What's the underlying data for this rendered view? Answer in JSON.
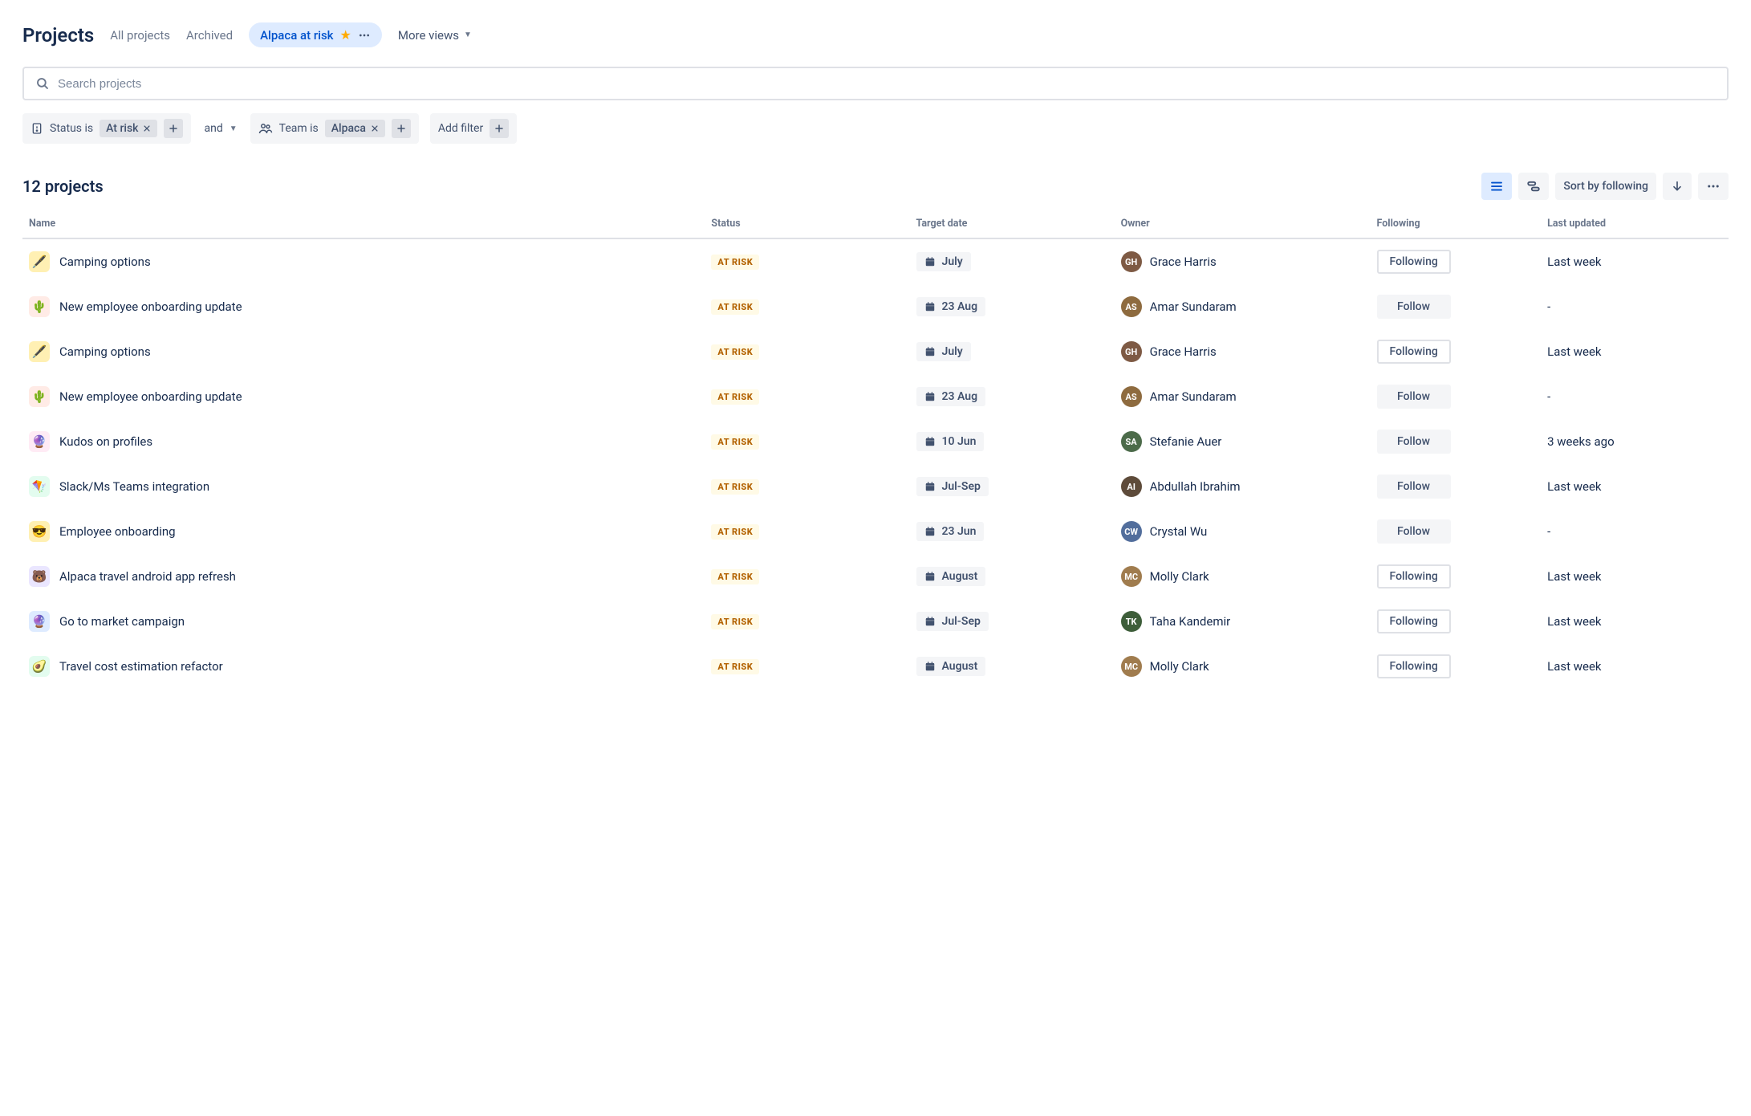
{
  "header": {
    "title": "Projects",
    "nav": {
      "all": "All projects",
      "archived": "Archived",
      "more_views": "More views"
    },
    "active_view": "Alpaca at risk"
  },
  "search": {
    "placeholder": "Search projects"
  },
  "filters": {
    "status_label": "Status is",
    "status_value": "At risk",
    "combiner": "and",
    "team_label": "Team is",
    "team_value": "Alpaca",
    "add_filter": "Add filter"
  },
  "toolbar": {
    "count": "12 projects",
    "sort_label": "Sort by following"
  },
  "columns": {
    "name": "Name",
    "status": "Status",
    "target_date": "Target date",
    "owner": "Owner",
    "following": "Following",
    "last_updated": "Last updated"
  },
  "status_badge": "AT RISK",
  "follow_labels": {
    "following": "Following",
    "follow": "Follow"
  },
  "rows": [
    {
      "icon": "🖋️",
      "icon_bg": "#FFF0B3",
      "name": "Camping options",
      "date": "July",
      "owner": "Grace Harris",
      "avatar_bg": "#7E5A44",
      "avatar_txt": "GH",
      "following": true,
      "updated": "Last week"
    },
    {
      "icon": "🌵",
      "icon_bg": "#FFEBE6",
      "name": "New employee onboarding update",
      "date": "23 Aug",
      "owner": "Amar Sundaram",
      "avatar_bg": "#8E6B3F",
      "avatar_txt": "AS",
      "following": false,
      "updated": "-"
    },
    {
      "icon": "🖋️",
      "icon_bg": "#FFF0B3",
      "name": "Camping options",
      "date": "July",
      "owner": "Grace Harris",
      "avatar_bg": "#7E5A44",
      "avatar_txt": "GH",
      "following": true,
      "updated": "Last week"
    },
    {
      "icon": "🌵",
      "icon_bg": "#FFEBE6",
      "name": "New employee onboarding update",
      "date": "23 Aug",
      "owner": "Amar Sundaram",
      "avatar_bg": "#8E6B3F",
      "avatar_txt": "AS",
      "following": false,
      "updated": "-"
    },
    {
      "icon": "🔮",
      "icon_bg": "#FFEBF5",
      "name": "Kudos on profiles",
      "date": "10 Jun",
      "owner": "Stefanie Auer",
      "avatar_bg": "#4C6B4A",
      "avatar_txt": "SA",
      "following": false,
      "updated": "3 weeks ago"
    },
    {
      "icon": "🪁",
      "icon_bg": "#E3FCEF",
      "name": "Slack/Ms Teams integration",
      "date": "Jul-Sep",
      "owner": "Abdullah Ibrahim",
      "avatar_bg": "#5E4B3A",
      "avatar_txt": "AI",
      "following": false,
      "updated": "Last week"
    },
    {
      "icon": "😎",
      "icon_bg": "#FFF0B3",
      "name": "Employee onboarding",
      "date": "23 Jun",
      "owner": "Crystal Wu",
      "avatar_bg": "#526E9C",
      "avatar_txt": "CW",
      "following": false,
      "updated": "-"
    },
    {
      "icon": "🐻",
      "icon_bg": "#EAE6FF",
      "name": "Alpaca travel android app refresh",
      "date": "August",
      "owner": "Molly Clark",
      "avatar_bg": "#A07C4E",
      "avatar_txt": "MC",
      "following": true,
      "updated": "Last week"
    },
    {
      "icon": "🔮",
      "icon_bg": "#DEEBFF",
      "name": "Go to market campaign",
      "date": "Jul-Sep",
      "owner": "Taha Kandemir",
      "avatar_bg": "#3E5E3A",
      "avatar_txt": "TK",
      "following": true,
      "updated": "Last week"
    },
    {
      "icon": "🥑",
      "icon_bg": "#E3FCEF",
      "name": "Travel cost estimation refactor",
      "date": "August",
      "owner": "Molly Clark",
      "avatar_bg": "#A07C4E",
      "avatar_txt": "MC",
      "following": true,
      "updated": "Last week"
    }
  ]
}
